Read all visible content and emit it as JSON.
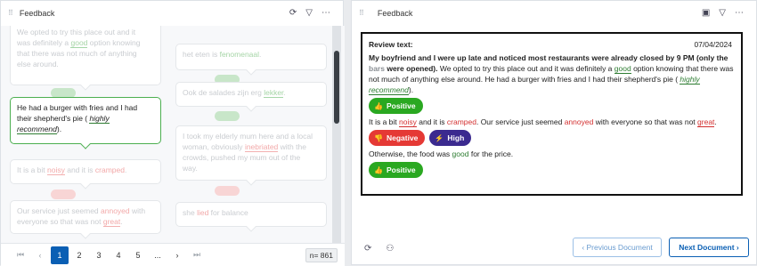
{
  "left_panel": {
    "title": "Feedback",
    "icons": [
      "refresh-settings-icon",
      "filter-icon",
      "more-icon"
    ],
    "cards": {
      "c1_line1": "We opted to try this place out and it",
      "c1_line2a": "was definitely a ",
      "c1_good": "good",
      "c1_line2b": " option knowing",
      "c1_line3": "that there was not much of anything",
      "c1_line4": "else around.",
      "c2_text_a": "het eten is ",
      "c2_word": "fenomenaal",
      "c2_text_b": ".",
      "c3_line1": "He had a burger with fries and I had",
      "c3_line2": "their shepherd's pie ( ",
      "c3_highly": "highly",
      "c3_recommend": "recommend",
      "c3_end": ").",
      "c4_text_a": "Ook de salades zijn erg ",
      "c4_word": "lekker",
      "c4_text_b": ".",
      "c5_text_a": "It is a bit ",
      "c5_noisy": "noisy",
      "c5_text_b": " and it is ",
      "c5_cramped": "cramped",
      "c5_text_c": ".",
      "c6_line1": "I took my elderly mum here and a local",
      "c6_line2a": "woman, ",
      "c6_obv": "obviously",
      "c6_line2b": " ",
      "c6_inebriated": "inebriated",
      "c6_line2c": " with the",
      "c6_line3": "crowds, pushed my mum out of the",
      "c6_line4": "way.",
      "c7_line1a": "Our service just seemed ",
      "c7_annoyed": "annoyed",
      "c7_line1b": " with",
      "c7_line2a": "everyone so that was not ",
      "c7_great": "great",
      "c7_line2b": ".",
      "c8_text_a": "she ",
      "c8_word": "lied",
      "c8_text_b": " for balance"
    },
    "pager": {
      "first": "⏮",
      "prev": "‹",
      "pages": [
        "1",
        "2",
        "3",
        "4",
        "5"
      ],
      "ellipsis": "...",
      "next": "›",
      "last": "⏭",
      "count": "n= 861"
    }
  },
  "right_panel": {
    "title": "Feedback",
    "icons": [
      "layout-icon",
      "filter-icon",
      "more-icon"
    ],
    "review_label": "Review text:",
    "date": "07/04/2024",
    "p1_b1": "My boyfriend and I were up late and noticed most restaurants were already closed by 9 PM (only the ",
    "p1_bars": "bars",
    "p1_b2": " were opened).",
    "p1_t1": " We opted to try this place out and it was definitely a ",
    "p1_good": "good",
    "p1_t2": " option knowing that there was not much of anything else around. He had a burger with fries and I had their shepherd's pie ( ",
    "p1_highly": "highly",
    "p1_recommend": "recommend",
    "p1_t3": ").",
    "tag_positive": "Positive",
    "p2_t1": "It is a bit ",
    "p2_noisy": "noisy",
    "p2_t2": " and it is ",
    "p2_cramped": "cramped",
    "p2_t3": ". Our service just seemed ",
    "p2_annoyed": "annoyed",
    "p2_t4": " with everyone so that was not ",
    "p2_great": "great",
    "p2_t5": ".",
    "tag_negative": "Negative",
    "tag_high": "High",
    "p3_t1": "Otherwise, the food was ",
    "p3_good": "good",
    "p3_t2": " for the price.",
    "tag_positive2": "Positive",
    "prev_button": "‹  Previous Document",
    "next_button": "Next Document  ›"
  },
  "colors": {
    "accent": "#0a5fb4",
    "positive": "#2aa821",
    "negative": "#e53935",
    "high": "#3b2a8f"
  }
}
